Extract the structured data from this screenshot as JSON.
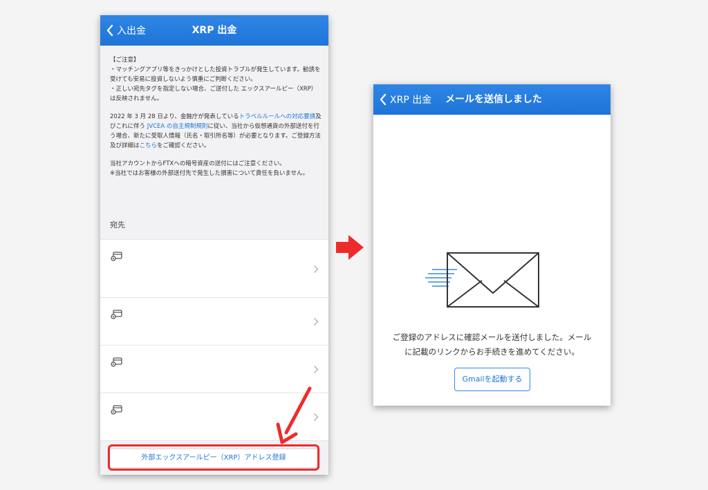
{
  "left_screen": {
    "back_label": "入出金",
    "title": "XRP 出金",
    "notice": {
      "heading": "【ご注意】",
      "bullet1": "・マッチングアプリ等をきっかけとした投資トラブルが発生しています。勧誘を受けても安易に投資しないよう慎重にご判断ください。",
      "bullet2": "・正しい宛先タグを指定しない場合、ご送付した エックスアールピー（XRP） は反映されません。",
      "travel_pre": "2022 年 3 月 28 日より、金融庁が発表している",
      "travel_link1": "トラベルルールへの対応要請",
      "travel_mid1": "及びこれに伴う ",
      "travel_link2": "JVCEA の自主規制規則",
      "travel_mid2": "に従い、当社から仮想通貨の外部送付を行う場合、新たに受取人情報（氏名・取引所名等）が必要となります。ご登録方法及び詳細は",
      "travel_link3": "こちら",
      "travel_post": "をご確認ください。",
      "ftx1": "当社アカウントからFTXへの暗号資産の送付にはご注意ください。",
      "ftx2": "※当社ではお客様の外部送付先で発生した損害について責任を負いません。"
    },
    "section_label": "宛先",
    "register_button": "外部エックスアールピー（XRP）アドレス登録"
  },
  "right_screen": {
    "back_label": "XRP 出金",
    "title": "メールを送信しました",
    "message_line1": "ご登録のアドレスに確認メールを送付しました。メール",
    "message_line2": "に記載のリンクからお手続きを進めてください。",
    "gmail_button": "Gmailを起動する"
  },
  "colors": {
    "nav_blue": "#1f74d8",
    "highlight_red": "#ee2b2b"
  },
  "icons": {
    "wallet": "wallet-icon",
    "chevron": "chevron-right-icon",
    "envelope": "envelope-icon"
  }
}
